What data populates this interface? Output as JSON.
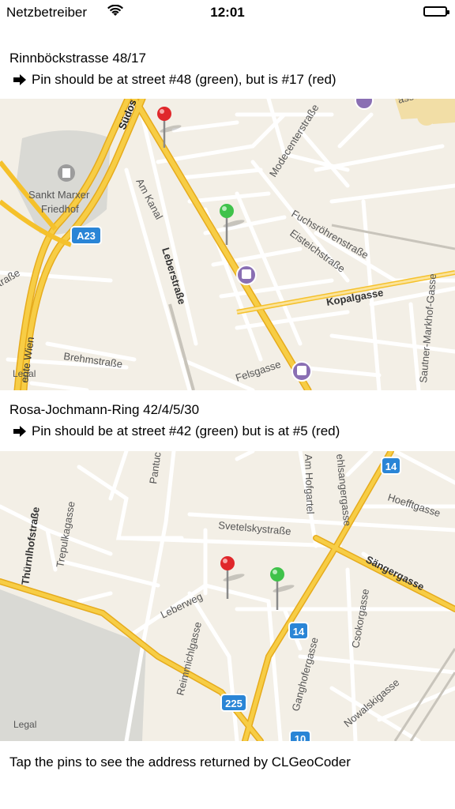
{
  "status_bar": {
    "carrier": "Netzbetreiber",
    "time": "12:01",
    "wifi_icon": "wifi-icon",
    "battery_icon": "battery-icon"
  },
  "section1": {
    "title": "Rinnböckstrasse 48/17",
    "note": "Pin should be at street #48 (green), but is #17 (red)",
    "map": {
      "legal": "Legal",
      "labels": {
        "suedost": "Südos",
        "sankt_marxer": "Sankt Marxer",
        "friedhof": "Friedhof",
        "a23": "A23",
        "am_kanal": "Am Kanal",
        "leberstrasse": "Leberstraße",
        "modecenter": "Modecenterstraße",
        "fuchsroehren": "Fuchsröhrenstraße",
        "eisteich": "Eisteichstraße",
        "kopalgasse": "Kopalgasse",
        "markhof": "Sautner-Markhof-Gasse",
        "brehmstrasse": "Brehmstraße",
        "felsgasse": "Felsgasse",
        "wien": "ente Wien",
        "strasse_left": "traße",
        "gasse_top": "asse"
      }
    }
  },
  "section2": {
    "title": "Rosa-Jochmann-Ring 42/4/5/30",
    "note": "Pin should be at street #42 (green) but is at #5 (red)",
    "map": {
      "legal": "Legal",
      "labels": {
        "thuernlhof": "Thürnlhofstraße",
        "trepulka": "Trepulkagasse",
        "pantuc": "Pantuc",
        "am_hofgartel": "Am Hofgartel",
        "ehlsanger": "ehlsangergasse",
        "hoefftgasse": "Hoefftgasse",
        "svetelsky": "Svetelskystraße",
        "saenger": "Sängergasse",
        "leberweg": "Leberweg",
        "reimmichl": "Reimmichlgasse",
        "csokor": "Csokorgasse",
        "ganghofer": "Ganghofergasse",
        "nowalski": "Nowalskigasse",
        "badge_14a": "14",
        "badge_14b": "14",
        "badge_225": "225",
        "badge_10": "10"
      }
    }
  },
  "footer": {
    "text": "Tap the pins to see the address returned by CLGeoCoder"
  },
  "colors": {
    "map_bg": "#f3efe6",
    "road_major": "#f5c12b",
    "pin_red": "#e0272b",
    "pin_green": "#3fc24a",
    "badge_blue": "#2a85d6",
    "transit_purple": "#8a6fb3"
  }
}
